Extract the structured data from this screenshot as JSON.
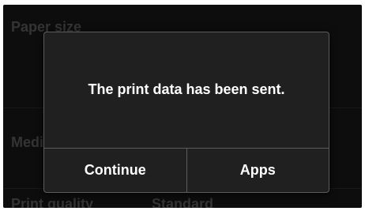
{
  "background": {
    "paper_size_label": "Paper size",
    "media_label": "Media type",
    "print_quality_label": "Print quality",
    "print_quality_value": "Standard"
  },
  "dialog": {
    "message": "The print data has been sent.",
    "continue_label": "Continue",
    "apps_label": "Apps"
  }
}
